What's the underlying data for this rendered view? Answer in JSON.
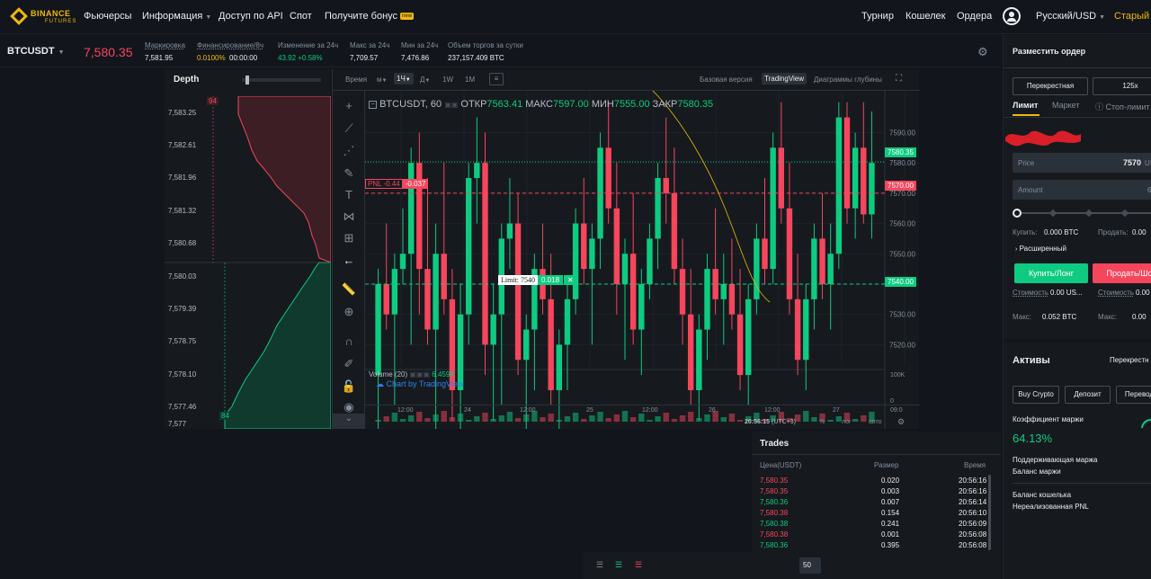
{
  "nav": {
    "logo_line1": "BINANCE",
    "logo_line2": "FUTURES",
    "items": [
      "Фьючерсы",
      "Информация",
      "Доступ по API",
      "Спот",
      "Получите бонус"
    ],
    "bonus_badge": "new",
    "right": [
      "Турнир",
      "Кошелек",
      "Ордера"
    ],
    "language": "Русский/USD",
    "old_version": "Старый с"
  },
  "ticker": {
    "symbol": "BTCUSDT",
    "price": "7,580.35",
    "mark_label": "Маркировка",
    "mark_value": "7,581.95",
    "funding_label": "Финансирование/8ч",
    "funding_rate": "0.0100%",
    "funding_time": "00:00:00",
    "change_label": "Изменение за 24ч",
    "change_value": "43.92 +0.58%",
    "high_label": "Макс за 24ч",
    "high_value": "7,709.57",
    "low_label": "Мин за 24ч",
    "low_value": "7,476.86",
    "volume_label": "Объем торгов за сутки",
    "volume_value": "237,157.409 BTC"
  },
  "depth": {
    "title": "Depth",
    "prices": [
      "7,583.25",
      "7,582.61",
      "7,581.96",
      "7,581.32",
      "7,580.68",
      "7,580.03",
      "7,579.39",
      "7,578.75",
      "7,578.10",
      "7,577.46",
      "7,577"
    ],
    "top_marker": "94",
    "bottom_marker": "84"
  },
  "chart": {
    "toolbar": {
      "time_label": "Время",
      "m": "м",
      "interval": "1Ч",
      "d": "Д",
      "w": "1W",
      "mo": "1M",
      "basic": "Базовая версия",
      "tradingview": "TradingView",
      "depth_charts": "Диаграммы глубины"
    },
    "legend": {
      "symbol": "BTCUSDT, 60",
      "open_label": "ОТКР",
      "open": "7563.41",
      "high_label": "МАКС",
      "high": "7597.00",
      "low_label": "МИН",
      "low": "7555.00",
      "close_label": "ЗАКР",
      "close": "7580.35"
    },
    "price_axis": [
      "7590.00",
      "7580.00",
      "7570.00",
      "7560.00",
      "7550.00",
      "7540.00",
      "7530.00",
      "7520.00"
    ],
    "last_price_tag": "7580.35",
    "pnl_tag_label": "PNL -0.44",
    "pnl_tag_value": "-0.037",
    "pnl_price_tag": "7570.00",
    "limit_label": "Limit: 7540",
    "limit_qty": "0.018",
    "limit_price_tag": "7540.00",
    "volume_label": "Volume (20)",
    "volume_value": "6.459K",
    "volume_axis": [
      "100K",
      "0"
    ],
    "watermark": "Chart by TradingView",
    "time_axis": [
      "12:00",
      "24",
      "12:00",
      "25",
      "12:00",
      "26",
      "12:00",
      "27",
      "09:0"
    ],
    "clock": "20:56:15",
    "utc": "(UTC+3)",
    "pct": "%",
    "log": "лог",
    "auto": "авто"
  },
  "order_panel": {
    "title": "Разместить ордер",
    "margin_mode": "Перекрестная",
    "leverage": "125x",
    "tabs": [
      "Лимит",
      "Маркет",
      "Стоп-лимит"
    ],
    "price_label": "Price",
    "price_value": "7570",
    "price_unit": "US",
    "amount_label": "Amount",
    "amount_suffix": "6",
    "buy_label": "Купить:",
    "buy_value": "0.000 BTC",
    "sell_label": "Продать:",
    "sell_value": "0.00",
    "advanced": "Расширенный",
    "buy_button": "Купить/Лонг",
    "sell_button": "Продать/Шо",
    "cost_label": "Стоимость",
    "cost_value": "0.00 US...",
    "cost_label2": "Стоимость",
    "cost_value2": "0.00",
    "max_label": "Макс:",
    "max_value": "0.052 BTC",
    "max_label2": "Макс:",
    "max_value2": "0.00",
    "assets_title": "Активы",
    "assets_mode": "Перекрестн",
    "buy_crypto": "Buy Crypto",
    "deposit": "Депозит",
    "transfer": "Перевод",
    "margin_ratio_label": "Коэффициент маржи",
    "margin_ratio_value": "64.13%",
    "maint_margin": "Поддерживающая маржа",
    "margin_balance": "Баланс маржи",
    "wallet_balance": "Баланс кошелька",
    "unrealized_pnl": "Нереализованная PNL"
  },
  "trades": {
    "title": "Trades",
    "headers": [
      "Цена(USDT)",
      "Размер",
      "Время"
    ],
    "rows": [
      {
        "price": "7,580.35",
        "size": "0.020",
        "time": "20:56:16",
        "side": "sell"
      },
      {
        "price": "7,580.35",
        "size": "0.003",
        "time": "20:56:16",
        "side": "sell"
      },
      {
        "price": "7,580.36",
        "size": "0.007",
        "time": "20:56:14",
        "side": "buy"
      },
      {
        "price": "7,580.38",
        "size": "0.154",
        "time": "20:56:10",
        "side": "sell"
      },
      {
        "price": "7,580.38",
        "size": "0.241",
        "time": "20:56:09",
        "side": "buy"
      },
      {
        "price": "7,580.38",
        "size": "0.001",
        "time": "20:56:08",
        "side": "sell"
      },
      {
        "price": "7,580.36",
        "size": "0.395",
        "time": "20:56:08",
        "side": "buy"
      }
    ]
  },
  "bottom": {
    "page_size": "50"
  },
  "colors": {
    "up": "#0ecb81",
    "down": "#f6465d",
    "accent": "#f0b90b",
    "bg": "#12161c",
    "panel": "#161a1e"
  },
  "candles": [
    [
      7510,
      7545,
      7490,
      7540
    ],
    [
      7540,
      7560,
      7525,
      7530
    ],
    [
      7530,
      7550,
      7500,
      7545
    ],
    [
      7545,
      7565,
      7540,
      7550
    ],
    [
      7550,
      7585,
      7520,
      7580
    ],
    [
      7580,
      7590,
      7530,
      7545
    ],
    [
      7545,
      7575,
      7520,
      7525
    ],
    [
      7525,
      7560,
      7480,
      7550
    ],
    [
      7550,
      7580,
      7530,
      7535
    ],
    [
      7535,
      7545,
      7495,
      7505
    ],
    [
      7505,
      7540,
      7470,
      7530
    ],
    [
      7530,
      7580,
      7520,
      7575
    ],
    [
      7575,
      7595,
      7560,
      7580
    ],
    [
      7580,
      7590,
      7510,
      7520
    ],
    [
      7520,
      7540,
      7495,
      7530
    ],
    [
      7530,
      7560,
      7500,
      7555
    ],
    [
      7555,
      7575,
      7545,
      7560
    ],
    [
      7560,
      7570,
      7510,
      7515
    ],
    [
      7515,
      7530,
      7480,
      7525
    ],
    [
      7525,
      7550,
      7505,
      7545
    ],
    [
      7545,
      7560,
      7530,
      7535
    ],
    [
      7535,
      7550,
      7500,
      7505
    ],
    [
      7505,
      7525,
      7490,
      7520
    ],
    [
      7520,
      7540,
      7505,
      7535
    ],
    [
      7535,
      7565,
      7530,
      7560
    ],
    [
      7560,
      7575,
      7540,
      7545
    ],
    [
      7545,
      7560,
      7520,
      7555
    ],
    [
      7555,
      7590,
      7545,
      7585
    ],
    [
      7585,
      7600,
      7560,
      7565
    ],
    [
      7565,
      7580,
      7530,
      7540
    ],
    [
      7540,
      7555,
      7515,
      7550
    ],
    [
      7550,
      7570,
      7520,
      7525
    ],
    [
      7525,
      7545,
      7510,
      7540
    ],
    [
      7540,
      7560,
      7535,
      7555
    ],
    [
      7555,
      7580,
      7545,
      7575
    ],
    [
      7575,
      7595,
      7560,
      7570
    ],
    [
      7570,
      7585,
      7540,
      7545
    ],
    [
      7545,
      7555,
      7520,
      7530
    ],
    [
      7530,
      7545,
      7500,
      7505
    ],
    [
      7505,
      7530,
      7495,
      7525
    ],
    [
      7525,
      7550,
      7515,
      7545
    ],
    [
      7545,
      7565,
      7530,
      7535
    ],
    [
      7535,
      7550,
      7520,
      7540
    ],
    [
      7540,
      7555,
      7525,
      7530
    ],
    [
      7530,
      7545,
      7505,
      7510
    ],
    [
      7510,
      7540,
      7500,
      7535
    ],
    [
      7535,
      7560,
      7530,
      7555
    ],
    [
      7555,
      7575,
      7540,
      7545
    ],
    [
      7545,
      7590,
      7540,
      7585
    ],
    [
      7585,
      7600,
      7560,
      7565
    ],
    [
      7565,
      7580,
      7530,
      7535
    ],
    [
      7535,
      7550,
      7510,
      7515
    ],
    [
      7515,
      7540,
      7505,
      7535
    ],
    [
      7535,
      7560,
      7525,
      7555
    ],
    [
      7555,
      7570,
      7535,
      7540
    ],
    [
      7540,
      7560,
      7525,
      7550
    ],
    [
      7550,
      7600,
      7545,
      7595
    ],
    [
      7595,
      7600,
      7560,
      7565
    ],
    [
      7565,
      7590,
      7555,
      7585
    ],
    [
      7585,
      7600,
      7560,
      7563
    ],
    [
      7563,
      7597,
      7555,
      7580
    ]
  ]
}
